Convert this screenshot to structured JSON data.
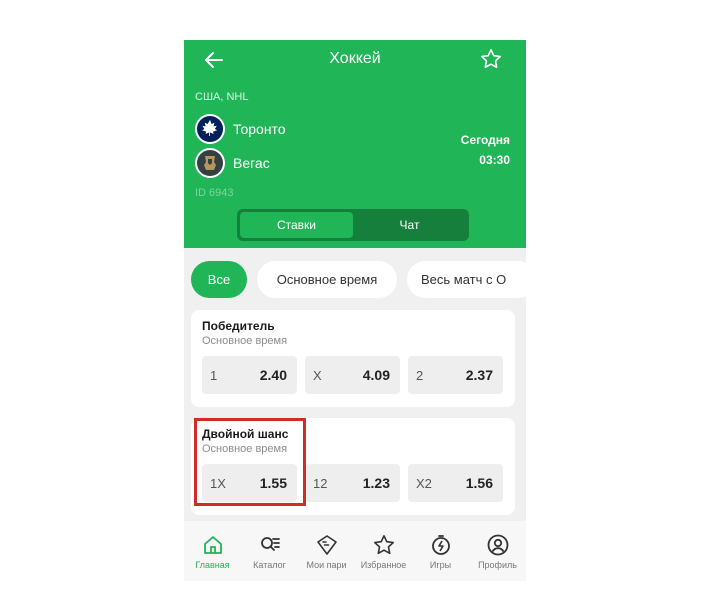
{
  "header": {
    "title": "Хоккей",
    "league": "США, NHL",
    "team1": "Торонто",
    "team2": "Вегас",
    "day": "Сегодня",
    "time": "03:30",
    "match_id": "ID 6943"
  },
  "tabs": [
    {
      "label": "Ставки",
      "active": true
    },
    {
      "label": "Чат",
      "active": false
    }
  ],
  "filters": [
    "Все",
    "Основное время",
    "Весь матч с О"
  ],
  "markets": [
    {
      "title": "Победитель",
      "subtitle": "Основное время",
      "odds": [
        {
          "label": "1",
          "value": "2.40"
        },
        {
          "label": "X",
          "value": "4.09"
        },
        {
          "label": "2",
          "value": "2.37"
        }
      ]
    },
    {
      "title": "Двойной шанс",
      "subtitle": "Основное время",
      "odds": [
        {
          "label": "1X",
          "value": "1.55"
        },
        {
          "label": "12",
          "value": "1.23"
        },
        {
          "label": "X2",
          "value": "1.56"
        }
      ]
    }
  ],
  "nav": [
    {
      "label": "Главная",
      "icon": "home-icon",
      "active": true
    },
    {
      "label": "Каталог",
      "icon": "catalog-search-icon",
      "active": false
    },
    {
      "label": "Мои пари",
      "icon": "ticket-icon",
      "active": false
    },
    {
      "label": "Избранное",
      "icon": "star-icon",
      "active": false
    },
    {
      "label": "Игры",
      "icon": "stopwatch-icon",
      "active": false
    },
    {
      "label": "Профиль",
      "icon": "profile-icon",
      "active": false
    }
  ],
  "colors": {
    "brand": "#20b556",
    "tab_bg": "#157f3b",
    "highlight": "#d22b2b"
  }
}
